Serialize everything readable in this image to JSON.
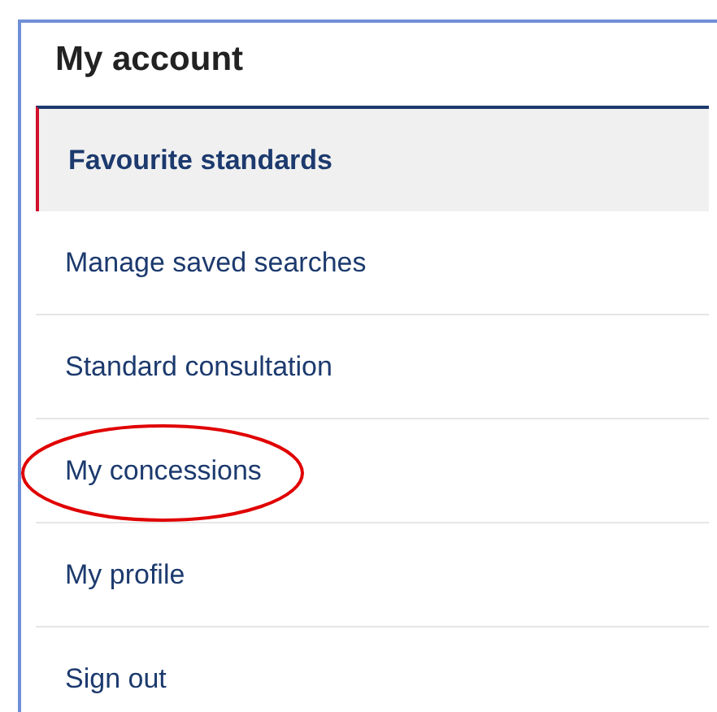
{
  "title": "My account",
  "items": [
    {
      "label": "Favourite standards",
      "selected": true,
      "circled": false
    },
    {
      "label": "Manage saved searches",
      "selected": false,
      "circled": false
    },
    {
      "label": "Standard consultation",
      "selected": false,
      "circled": false
    },
    {
      "label": "My concessions",
      "selected": false,
      "circled": true
    },
    {
      "label": "My profile",
      "selected": false,
      "circled": false
    },
    {
      "label": "Sign out",
      "selected": false,
      "circled": false
    }
  ]
}
